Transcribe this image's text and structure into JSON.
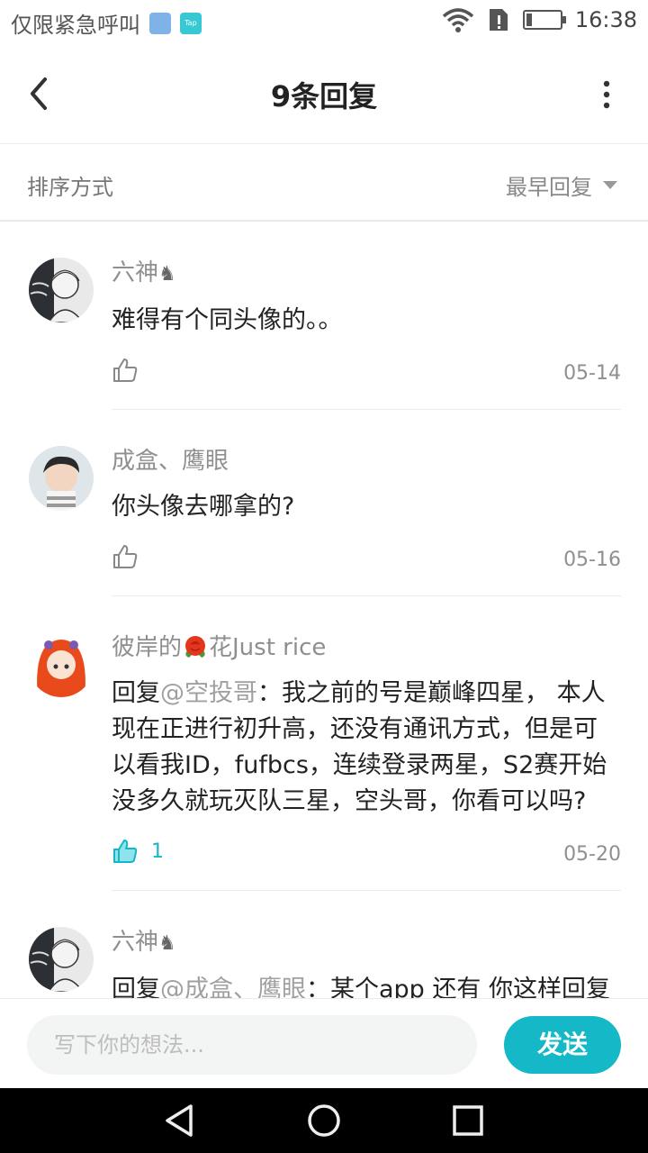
{
  "status_bar": {
    "carrier": "仅限紧急呼叫",
    "time": "16:38",
    "app_icon_2_text": "Tap"
  },
  "header": {
    "title": "9条回复"
  },
  "sort": {
    "label": "排序方式",
    "selected": "最早回复"
  },
  "comments": [
    {
      "username": "六神",
      "username_suffix": "♞",
      "content": "难得有个同头像的。。",
      "likes": "",
      "date": "05-14",
      "liked": false
    },
    {
      "username": "成盒、鹰眼",
      "username_suffix": "",
      "content": "你头像去哪拿的?",
      "likes": "",
      "date": "05-16",
      "liked": false
    },
    {
      "username_pre": "彼岸的",
      "username_post": "花Just rice",
      "reply_prefix": "回复",
      "mention": "@空投哥",
      "content": "：我之前的号是巅峰四星， 本人现在正进行初升高，还没有通讯方式，但是可以看我ID，fufbcs，连续登录两星，S2赛开始没多久就玩灭队三星，空头哥，你看可以吗?",
      "likes": "1",
      "date": "05-20",
      "liked": true
    },
    {
      "username": "六神",
      "username_suffix": "♞",
      "reply_prefix": "回复",
      "mention": "@成盒、鹰眼",
      "content": "：某个app 还有 你这样回复",
      "likes": "",
      "date": "",
      "liked": false
    }
  ],
  "input": {
    "placeholder": "写下你的想法...",
    "send_label": "发送"
  },
  "colors": {
    "accent": "#14b8c6",
    "muted_text": "#8f8f8f",
    "divider": "#ececec"
  }
}
